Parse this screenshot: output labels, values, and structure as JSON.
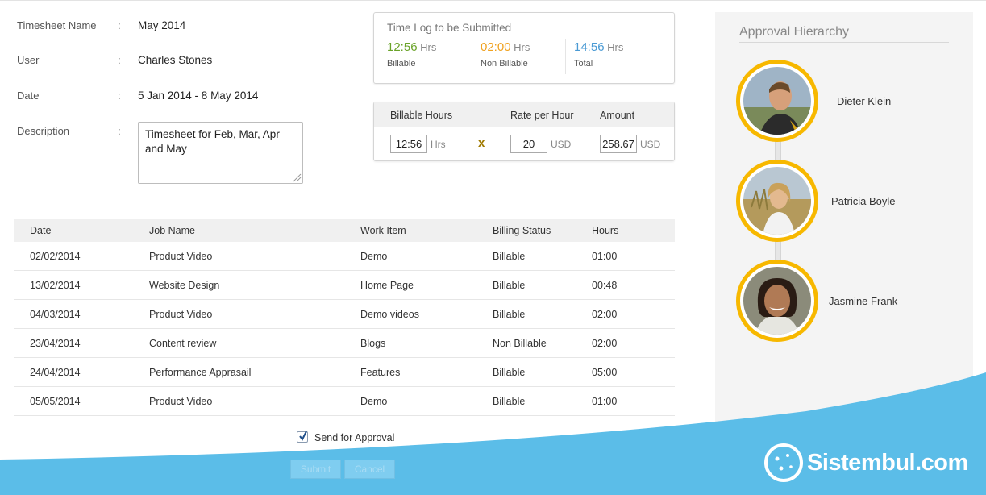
{
  "form": {
    "colon": ":",
    "timesheet_name_label": "Timesheet Name",
    "timesheet_name": "May 2014",
    "user_label": "User",
    "user": "Charles Stones",
    "date_label": "Date",
    "date": "5 Jan 2014 - 8 May 2014",
    "description_label": "Description",
    "description": "Timesheet for Feb, Mar, Apr and May"
  },
  "time_log": {
    "title": "Time Log to be Submitted",
    "unit": "Hrs",
    "billable": {
      "value": "12:56",
      "label": "Billable",
      "color": "#6aa329"
    },
    "non_billable": {
      "value": "02:00",
      "label": "Non Billable",
      "color": "#f0a220"
    },
    "total": {
      "value": "14:56",
      "label": "Total",
      "color": "#4a9ad4"
    }
  },
  "calc": {
    "billable_hours_header": "Billable Hours",
    "rate_header": "Rate per Hour",
    "amount_header": "Amount",
    "hours_value": "12:56",
    "hours_unit": "Hrs",
    "multiply": "x",
    "rate_value": "20",
    "rate_unit": "USD",
    "amount_value": "258.67",
    "amount_unit": "USD"
  },
  "table": {
    "headers": [
      "Date",
      "Job Name",
      "Work Item",
      "Billing Status",
      "Hours"
    ],
    "rows": [
      [
        "02/02/2014",
        "Product Video",
        "Demo",
        "Billable",
        "01:00"
      ],
      [
        "13/02/2014",
        "Website Design",
        "Home Page",
        "Billable",
        "00:48"
      ],
      [
        "04/03/2014",
        "Product Video",
        "Demo videos",
        "Billable",
        "02:00"
      ],
      [
        "23/04/2014",
        "Content review",
        "Blogs",
        "Non Billable",
        "02:00"
      ],
      [
        "24/04/2014",
        "Performance Apprasail",
        "Features",
        "Billable",
        "05:00"
      ],
      [
        "05/05/2014",
        "Product Video",
        "Demo",
        "Billable",
        "01:00"
      ]
    ]
  },
  "approval": {
    "send_label": "Send for Approval",
    "send_checked": true,
    "submit_label": "Submit",
    "cancel_label": "Cancel"
  },
  "hierarchy": {
    "title": "Approval Hierarchy",
    "people": [
      {
        "name": "Dieter Klein",
        "icon": "person-photo-icon"
      },
      {
        "name": "Patricia Boyle",
        "icon": "person-photo-icon"
      },
      {
        "name": "Jasmine Frank",
        "icon": "person-photo-icon"
      }
    ],
    "ring_color": "#f7b800"
  },
  "watermark": {
    "text": "Sistembul.com",
    "color": "#5bbde8"
  }
}
